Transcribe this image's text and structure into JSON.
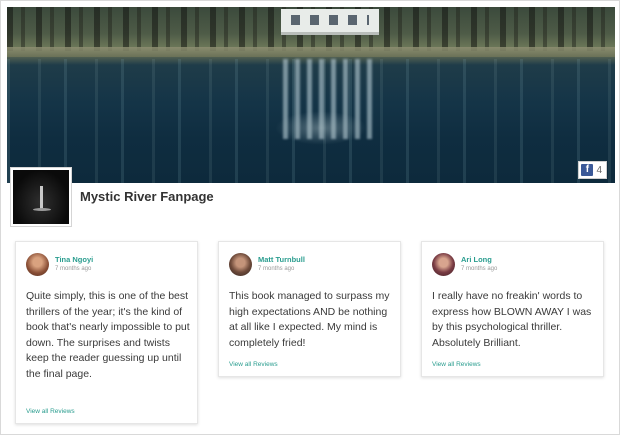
{
  "page": {
    "name": "Mystic River Fanpage",
    "facebook_count": "4"
  },
  "reviews": [
    {
      "reviewer": "Tina Ngoyi",
      "time": "7 months ago",
      "text": "Quite simply, this is one of the best thrillers of the year; it's the kind of book that's nearly impossible to put down. The surprises and twists keep the reader guessing up until the final page.",
      "link": "View all Reviews",
      "avatar_color": "#b86a4e"
    },
    {
      "reviewer": "Matt Turnbull",
      "time": "7 months ago",
      "text": "This book managed to surpass my high expectations AND be nothing at all like I expected. My mind is completely fried!",
      "link": "View all Reviews",
      "avatar_color": "#7a5848"
    },
    {
      "reviewer": "Ari Long",
      "time": "7 months ago",
      "text": "I really have no freakin' words to express how BLOWN AWAY I was by this psychological thriller. Absolutely Brilliant.",
      "link": "View all Reviews",
      "avatar_color": "#8a4a52"
    }
  ],
  "colors": {
    "accent": "#2a9d8f",
    "facebook": "#3b5998"
  },
  "icons": {
    "facebook": "facebook-icon"
  }
}
